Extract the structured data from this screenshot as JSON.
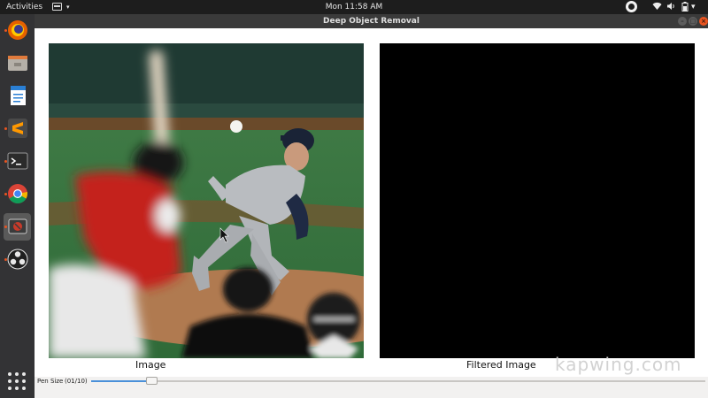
{
  "topbar": {
    "activities_label": "Activities",
    "clock": "Mon 11:58 AM",
    "tray_icons": [
      "obs-tray-icon",
      "wifi-icon",
      "volume-icon",
      "battery-icon",
      "power-icon"
    ]
  },
  "dock": {
    "items": [
      {
        "name": "firefox-icon",
        "running": true
      },
      {
        "name": "file-manager-icon",
        "running": false
      },
      {
        "name": "libreoffice-writer-icon",
        "running": false
      },
      {
        "name": "sublime-text-icon",
        "running": true
      },
      {
        "name": "terminal-icon",
        "running": true
      },
      {
        "name": "chrome-icon",
        "running": true
      },
      {
        "name": "deep-object-removal-app-icon",
        "running": true,
        "active": true
      },
      {
        "name": "obs-studio-icon",
        "running": true
      }
    ],
    "apps_grid_icon": "show-applications-icon"
  },
  "window": {
    "title": "Deep Object Removal"
  },
  "panels": {
    "image_caption": "Image",
    "filtered_caption": "Filtered Image",
    "watermark": "kapwing.com"
  },
  "pen": {
    "label": "Pen Size",
    "value": "(01/10)",
    "level": 0.1
  },
  "colors": {
    "accent": "#e95420",
    "slider_fill": "#4a90d9",
    "filtered_background": "#000000"
  }
}
